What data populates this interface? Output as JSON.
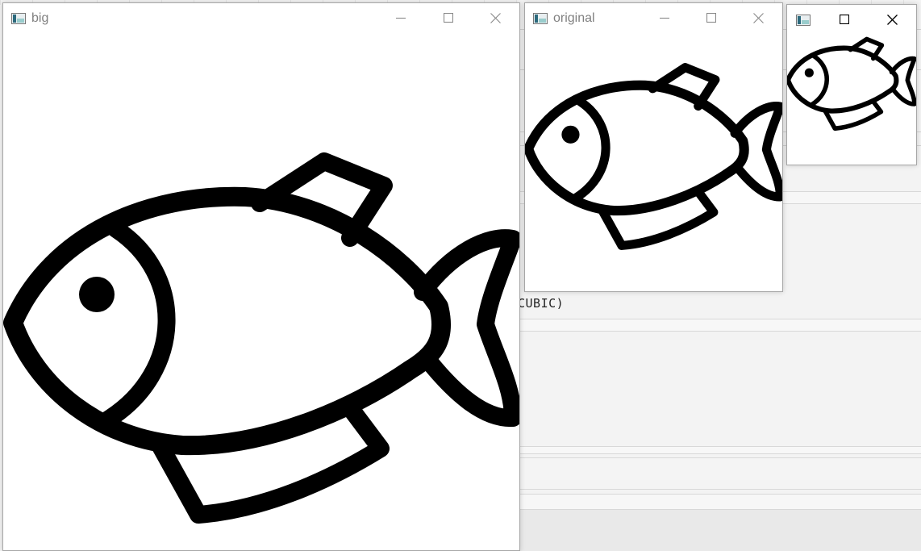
{
  "background": {
    "code_fragment": "CUBIC)"
  },
  "windows": {
    "big": {
      "title": "big"
    },
    "original": {
      "title": "original"
    },
    "small": {
      "title": ""
    }
  },
  "icons": {
    "app": "app-icon",
    "minimize": "minimize-icon",
    "maximize": "maximize-icon",
    "close": "close-icon",
    "image": "fish-image"
  },
  "colors": {
    "title_inactive": "#808080",
    "window_bg": "#ffffff",
    "fish_stroke": "#000000"
  }
}
